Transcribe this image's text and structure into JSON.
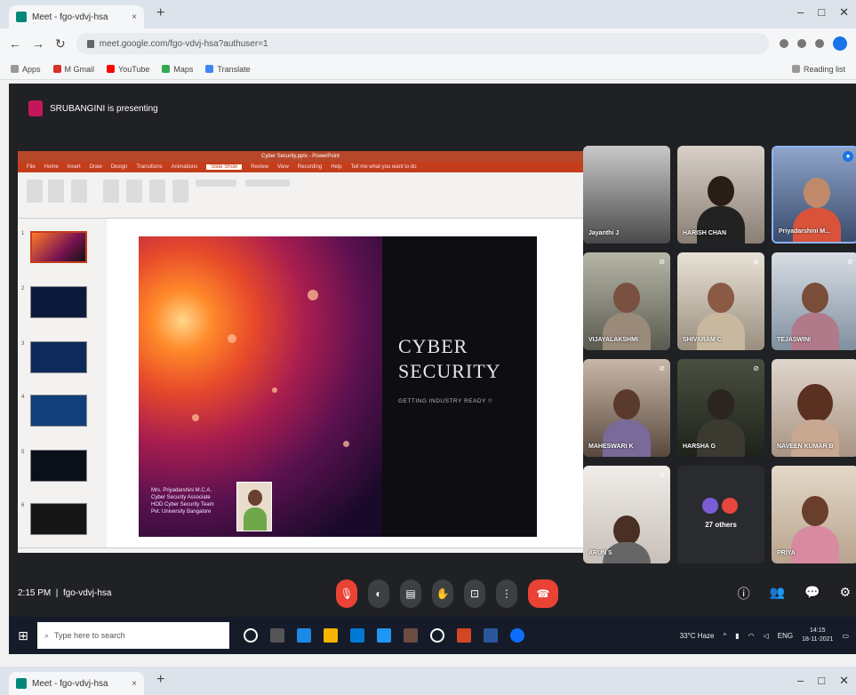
{
  "browser": {
    "tab_title": "Meet - fgo-vdvj-hsa",
    "tab_close": "×",
    "new_tab": "+",
    "window_controls": [
      "–",
      "□",
      "✕"
    ],
    "url": "meet.google.com/fgo-vdvj-hsa?authuser=1",
    "nav": {
      "back": "←",
      "forward": "→",
      "reload": "↻"
    },
    "bookmarks": [
      "Apps",
      "M Gmail",
      "YouTube",
      "Maps",
      "Translate"
    ],
    "reading_list": "Reading list"
  },
  "meet": {
    "presenting_text": "SRUBANGINI is presenting",
    "time": "2:15 PM",
    "meeting_code": "fgo-vdvj-hsa",
    "controls": {
      "mic": "🎙",
      "camera": "◐",
      "captions": "▤",
      "hand": "✋",
      "present": "⊡",
      "more": "⋮",
      "end_call": "☎"
    },
    "right_controls": [
      "ⓘ",
      "👥",
      "💬",
      "⚙"
    ],
    "others_label": "27 others",
    "participants": [
      {
        "name": "Jayanthi J"
      },
      {
        "name": "HARISH CHAN"
      },
      {
        "name": "Priyadarshini M..."
      },
      {
        "name": "VIJAYALAKSHMI"
      },
      {
        "name": "SHIVARAM C"
      },
      {
        "name": "TEJASWINI"
      },
      {
        "name": "MAHESWARI K"
      },
      {
        "name": "HARSHA G"
      },
      {
        "name": "NAVEEN KUMAR B"
      },
      {
        "name": "ARUN S"
      },
      {
        "name": "27 others"
      },
      {
        "name": "PRIYA"
      }
    ]
  },
  "slide": {
    "title_line1": "CYBER",
    "title_line2": "SECURITY",
    "subtitle": "GETTING INDUSTRY READY !!",
    "author": [
      "Mrs. Priyadarshini M.C.A.",
      "Cyber Security Associate",
      "HOD Cyber Security Team",
      "Pvt. University Bangalore"
    ],
    "ppt_window_title": "Cyber Security.pptx - PowerPoint",
    "ppt_tabs": [
      "File",
      "Home",
      "Insert",
      "Draw",
      "Design",
      "Transitions",
      "Animations",
      "Slide Show",
      "Review",
      "View",
      "Recording",
      "Help",
      "Tell me what you want to do"
    ],
    "active_tab": "Slide Show",
    "slide_numbers": [
      "1",
      "2",
      "3",
      "4",
      "5",
      "6"
    ]
  },
  "taskbar": {
    "start": "⊞",
    "search_placeholder": "Type here to search",
    "weather": "33°C Haze",
    "language": "ENG",
    "time": "14:15",
    "date": "18-11-2021"
  },
  "colors": {
    "meet_bg": "#202124",
    "ppt_accent": "#c43e1c",
    "end_call": "#ea4335",
    "taskbar": "#151b28"
  }
}
